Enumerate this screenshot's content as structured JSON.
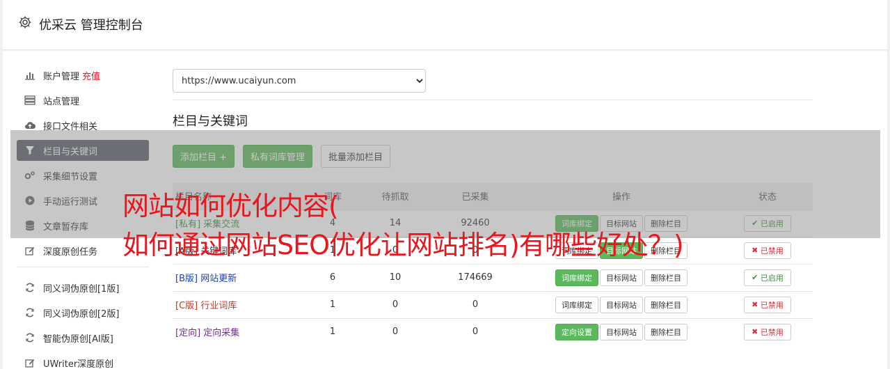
{
  "header": {
    "title": "优采云 管理控制台",
    "icon": "gear-icon"
  },
  "sidebar": {
    "items": [
      {
        "label": "账户管理",
        "extra": "充值",
        "icon": "bar-chart-icon"
      },
      {
        "label": "站点管理",
        "icon": "server-icon"
      },
      {
        "label": "接口文件相关",
        "icon": "cloud-upload-icon"
      },
      {
        "label": "栏目与关键词",
        "icon": "filter-icon",
        "active": true
      },
      {
        "label": "采集细节设置",
        "icon": "cogs-icon"
      },
      {
        "label": "手动运行测试",
        "icon": "play-circle-icon"
      },
      {
        "label": "文章暂存库",
        "icon": "database-icon"
      },
      {
        "label": "深度原创任务",
        "icon": "edit-icon"
      }
    ],
    "items2": [
      {
        "label": "同义词伪原创[1版]",
        "icon": "refresh-icon"
      },
      {
        "label": "同义词伪原创[2版]",
        "icon": "refresh-icon"
      },
      {
        "label": "智能伪原创[AI版]",
        "icon": "refresh-icon"
      },
      {
        "label": "UWriter深度原创",
        "icon": "edit-icon"
      }
    ]
  },
  "site_select": {
    "value": "https://www.ucaiyun.com"
  },
  "section": {
    "title": "栏目与关键词"
  },
  "buttons": {
    "add": "添加栏目 +",
    "private_lib": "私有词库管理",
    "batch_add": "批量添加栏目"
  },
  "table": {
    "headers": [
      "栏目名称",
      "词库",
      "待抓取",
      "已采集",
      "操作",
      "状态"
    ],
    "rows": [
      {
        "tag": "[私有]",
        "name": "采集交流",
        "lib": "4",
        "pending": "14",
        "collected": "92460",
        "op1": "词库绑定",
        "op2": "目标网站",
        "op3": "删除栏目",
        "status": "已启用",
        "enabled": true
      },
      {
        "tag": "[A版]",
        "name": "关键词库",
        "lib": "1",
        "pending": "0",
        "collected": "0",
        "op1": "词库绑定",
        "op2": "目标网站",
        "op3": "删除栏目",
        "status": "已禁用",
        "enabled": false
      },
      {
        "tag": "[B版]",
        "name": "网站更新",
        "lib": "6",
        "pending": "10",
        "collected": "174669",
        "op1": "词库绑定",
        "op2": "目标网站",
        "op3": "删除栏目",
        "status": "已启用",
        "enabled": true
      },
      {
        "tag": "[C版]",
        "name": "行业词库",
        "lib": "1",
        "pending": "0",
        "collected": "0",
        "op1": "词库绑定",
        "op2": "目标网站",
        "op3": "删除栏目",
        "status": "已禁用",
        "enabled": false
      },
      {
        "tag": "[定向]",
        "name": "定向采集",
        "lib": "1",
        "pending": "0",
        "collected": "0",
        "op1": "定向设置",
        "op2": "目标网站",
        "op3": "删除栏目",
        "status": "已禁用",
        "enabled": false
      }
    ]
  },
  "overlay": {
    "line1": "网站如何优化内容(",
    "line2": "如何通过网站SEO优化让网站排名)有哪些好处？)"
  },
  "colors": {
    "green": "#5cb85c",
    "active_bg": "#58606a",
    "overlay_text": "#e8161d"
  }
}
